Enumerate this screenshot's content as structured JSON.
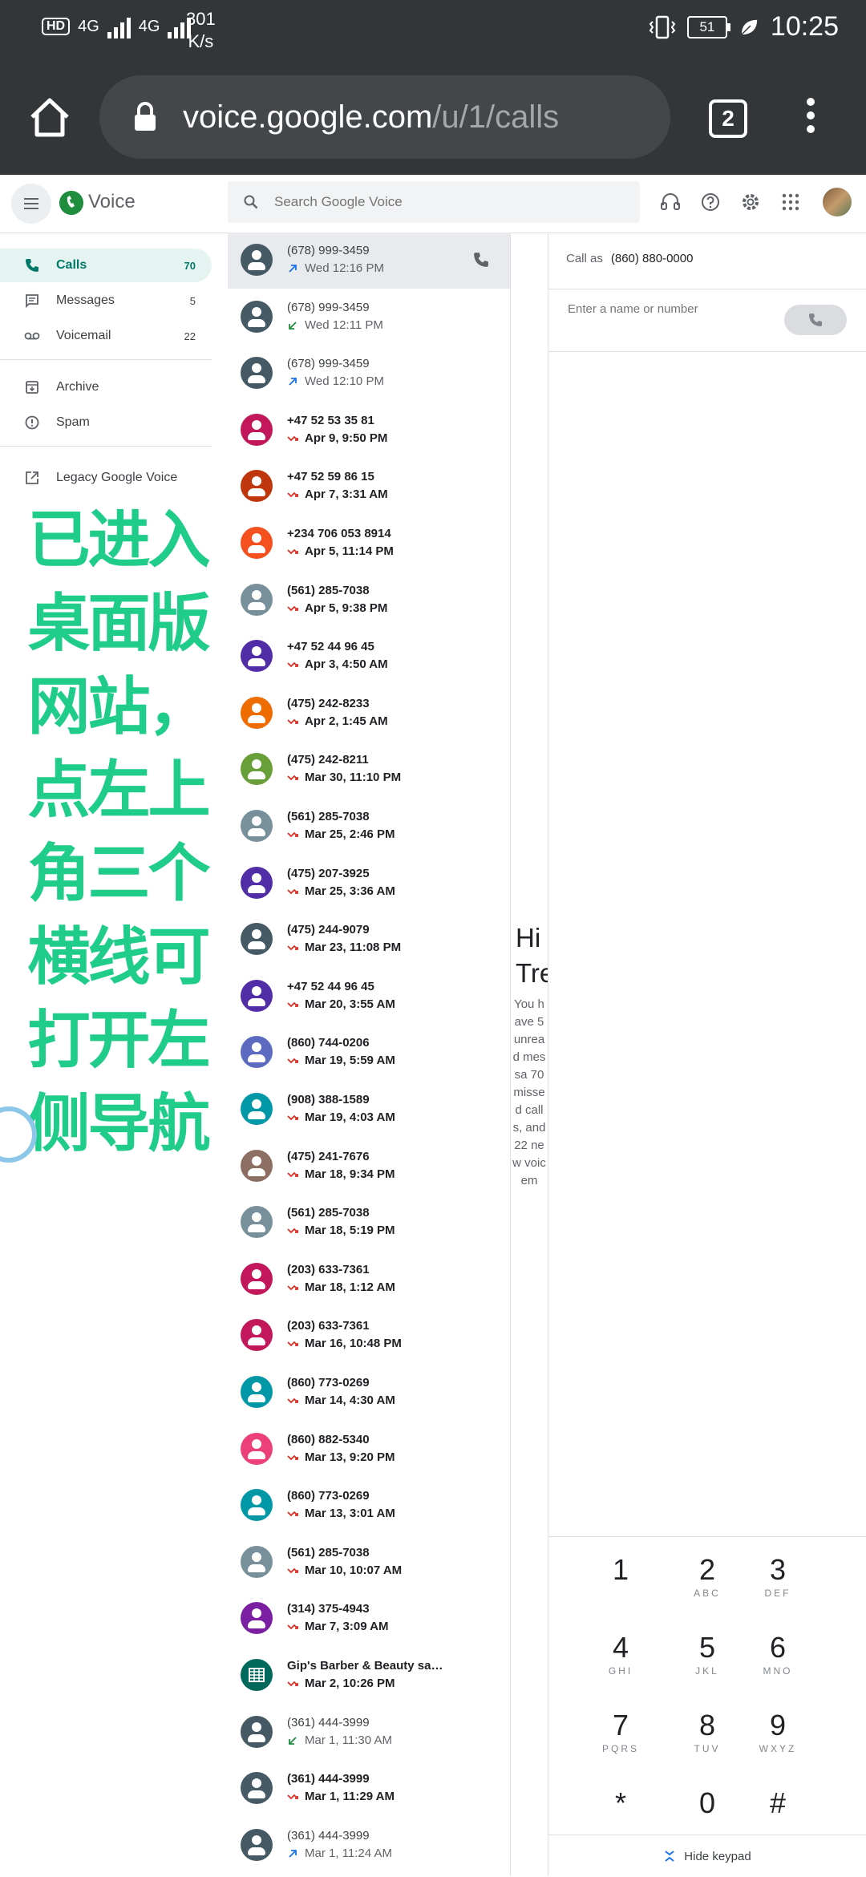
{
  "statusbar": {
    "hd_badge": "HD",
    "net1": "4G",
    "net2": "4G",
    "speed_value": "301",
    "speed_unit": "K/s",
    "battery": "51",
    "time": "10:25"
  },
  "browser": {
    "url_host": "voice.google.com",
    "url_path": "/u/1/calls",
    "tab_count": "2"
  },
  "header": {
    "app_name": "Voice",
    "search_placeholder": "Search Google Voice"
  },
  "nav": {
    "items": [
      {
        "label": "Calls",
        "count": "70"
      },
      {
        "label": "Messages",
        "count": "5"
      },
      {
        "label": "Voicemail",
        "count": "22"
      },
      {
        "label": "Archive",
        "count": ""
      },
      {
        "label": "Spam",
        "count": ""
      },
      {
        "label": "Legacy Google Voice",
        "count": ""
      }
    ]
  },
  "overlay": {
    "lines": [
      "已进入",
      "桌面版",
      "网站，",
      "点左上",
      "角三个",
      "横线可",
      "打开左",
      "侧导航"
    ]
  },
  "calls": [
    {
      "number": "(678) 999-3459",
      "time": "Wed 12:16 PM",
      "dir": "outgoing",
      "color": "#455a64",
      "bold": false
    },
    {
      "number": "(678) 999-3459",
      "time": "Wed 12:11 PM",
      "dir": "incoming",
      "color": "#455a64",
      "bold": false
    },
    {
      "number": "(678) 999-3459",
      "time": "Wed 12:10 PM",
      "dir": "outgoing",
      "color": "#455a64",
      "bold": false
    },
    {
      "number": "+47 52 53 35 81",
      "time": "Apr 9, 9:50 PM",
      "dir": "missed",
      "color": "#c2185b",
      "bold": true
    },
    {
      "number": "+47 52 59 86 15",
      "time": "Apr 7, 3:31 AM",
      "dir": "missed",
      "color": "#bf360c",
      "bold": true
    },
    {
      "number": "+234 706 053 8914",
      "time": "Apr 5, 11:14 PM",
      "dir": "missed",
      "color": "#f4511e",
      "bold": true
    },
    {
      "number": "(561) 285-7038",
      "time": "Apr 5, 9:38 PM",
      "dir": "missed",
      "color": "#78909c",
      "bold": true
    },
    {
      "number": "+47 52 44 96 45",
      "time": "Apr 3, 4:50 AM",
      "dir": "missed",
      "color": "#512da8",
      "bold": true
    },
    {
      "number": "(475) 242-8233",
      "time": "Apr 2, 1:45 AM",
      "dir": "missed",
      "color": "#ef6c00",
      "bold": true
    },
    {
      "number": "(475) 242-8211",
      "time": "Mar 30, 11:10 PM",
      "dir": "missed",
      "color": "#689f38",
      "bold": true
    },
    {
      "number": "(561) 285-7038",
      "time": "Mar 25, 2:46 PM",
      "dir": "missed",
      "color": "#78909c",
      "bold": true
    },
    {
      "number": "(475) 207-3925",
      "time": "Mar 25, 3:36 AM",
      "dir": "missed",
      "color": "#512da8",
      "bold": true
    },
    {
      "number": "(475) 244-9079",
      "time": "Mar 23, 11:08 PM",
      "dir": "missed",
      "color": "#455a64",
      "bold": true
    },
    {
      "number": "+47 52 44 96 45",
      "time": "Mar 20, 3:55 AM",
      "dir": "missed",
      "color": "#512da8",
      "bold": true
    },
    {
      "number": "(860) 744-0206",
      "time": "Mar 19, 5:59 AM",
      "dir": "missed",
      "color": "#5c6bc0",
      "bold": true
    },
    {
      "number": "(908) 388-1589",
      "time": "Mar 19, 4:03 AM",
      "dir": "missed",
      "color": "#0097a7",
      "bold": true
    },
    {
      "number": "(475) 241-7676",
      "time": "Mar 18, 9:34 PM",
      "dir": "missed",
      "color": "#8d6e63",
      "bold": true
    },
    {
      "number": "(561) 285-7038",
      "time": "Mar 18, 5:19 PM",
      "dir": "missed",
      "color": "#78909c",
      "bold": true
    },
    {
      "number": "(203) 633-7361",
      "time": "Mar 18, 1:12 AM",
      "dir": "missed",
      "color": "#c2185b",
      "bold": true
    },
    {
      "number": "(203) 633-7361",
      "time": "Mar 16, 10:48 PM",
      "dir": "missed",
      "color": "#c2185b",
      "bold": true
    },
    {
      "number": "(860) 773-0269",
      "time": "Mar 14, 4:30 AM",
      "dir": "missed",
      "color": "#0097a7",
      "bold": true
    },
    {
      "number": "(860) 882-5340",
      "time": "Mar 13, 9:20 PM",
      "dir": "missed",
      "color": "#ec407a",
      "bold": true
    },
    {
      "number": "(860) 773-0269",
      "time": "Mar 13, 3:01 AM",
      "dir": "missed",
      "color": "#0097a7",
      "bold": true
    },
    {
      "number": "(561) 285-7038",
      "time": "Mar 10, 10:07 AM",
      "dir": "missed",
      "color": "#78909c",
      "bold": true
    },
    {
      "number": "(314) 375-4943",
      "time": "Mar 7, 3:09 AM",
      "dir": "missed",
      "color": "#7b1fa2",
      "bold": true
    },
    {
      "number": "Gip's Barber & Beauty sa…",
      "time": "Mar 2, 10:26 PM",
      "dir": "missed",
      "color": "#00695c",
      "bold": true,
      "business": true
    },
    {
      "number": "(361) 444-3999",
      "time": "Mar 1, 11:30 AM",
      "dir": "incoming",
      "color": "#455a64",
      "bold": false
    },
    {
      "number": "(361) 444-3999",
      "time": "Mar 1, 11:29 AM",
      "dir": "missed",
      "color": "#455a64",
      "bold": true
    },
    {
      "number": "(361) 444-3999",
      "time": "Mar 1, 11:24 AM",
      "dir": "outgoing",
      "color": "#455a64",
      "bold": false
    }
  ],
  "middle": {
    "greeting": "Hi Tre",
    "summary": "You have 5 unread messa 70 missed calls, and 22 new voicem"
  },
  "dialer": {
    "call_as_label": "Call as",
    "call_as_number": "(860) 880-0000",
    "input_placeholder": "Enter a name or number",
    "keys": [
      {
        "d": "1",
        "l": ""
      },
      {
        "d": "2",
        "l": "ABC"
      },
      {
        "d": "3",
        "l": "DEF"
      },
      {
        "d": "4",
        "l": "GHI"
      },
      {
        "d": "5",
        "l": "JKL"
      },
      {
        "d": "6",
        "l": "MNO"
      },
      {
        "d": "7",
        "l": "PQRS"
      },
      {
        "d": "8",
        "l": "TUV"
      },
      {
        "d": "9",
        "l": "WXYZ"
      },
      {
        "d": "*",
        "l": ""
      },
      {
        "d": "0",
        "l": ""
      },
      {
        "d": "#",
        "l": ""
      }
    ],
    "hide_keypad": "Hide keypad"
  },
  "colors": {
    "accent": "#00796b",
    "overlay_text": "#1fcc8a",
    "chrome_bar": "#333639",
    "missed": "#d93025",
    "outgoing": "#1a73e8",
    "incoming": "#1e8e3e"
  }
}
